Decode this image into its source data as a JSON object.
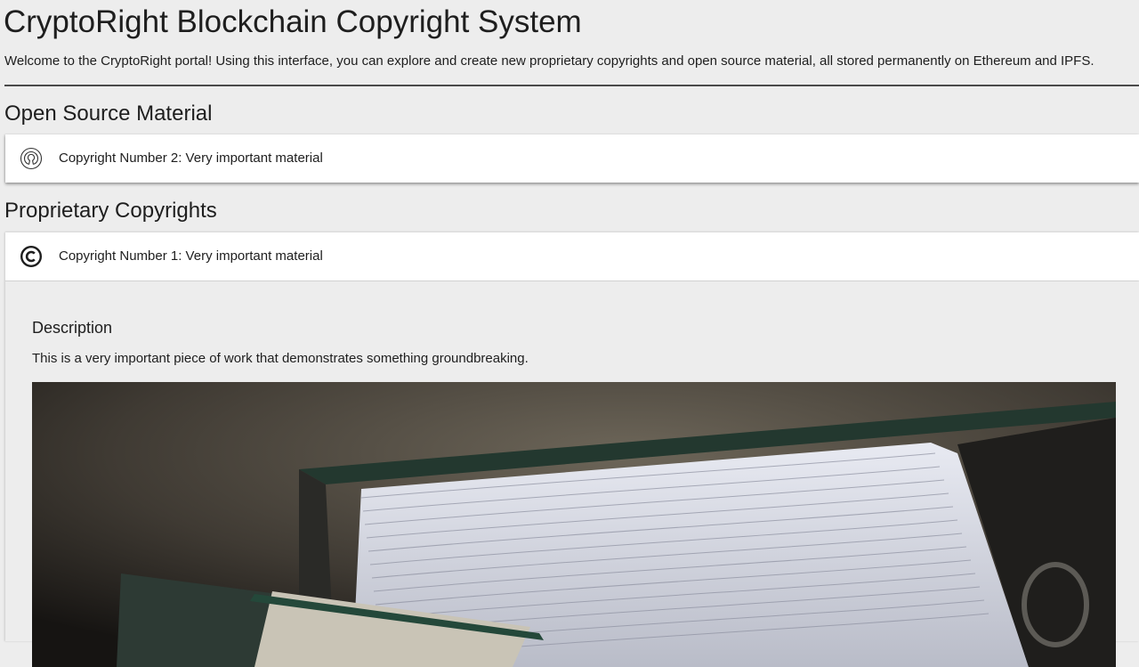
{
  "header": {
    "title": "CryptoRight Blockchain Copyright System",
    "intro": "Welcome to the CryptoRight portal! Using this interface, you can explore and create new proprietary copyrights and open source material, all stored permanently on Ethereum and IPFS."
  },
  "open_source": {
    "heading": "Open Source Material",
    "items": [
      {
        "label": "Copyright Number 2: Very important material",
        "icon": "open-source-icon"
      }
    ]
  },
  "proprietary": {
    "heading": "Proprietary Copyrights",
    "items": [
      {
        "label": "Copyright Number 1: Very important material",
        "icon": "copyright-icon",
        "expanded": true,
        "description_heading": "Description",
        "description": "This is a very important piece of work that demonstrates something groundbreaking.",
        "image": "document-binder-photo"
      }
    ]
  },
  "colors": {
    "background": "#ededed",
    "card": "#ffffff",
    "text": "#1e1e1e",
    "divider": "#4a4a4a"
  }
}
